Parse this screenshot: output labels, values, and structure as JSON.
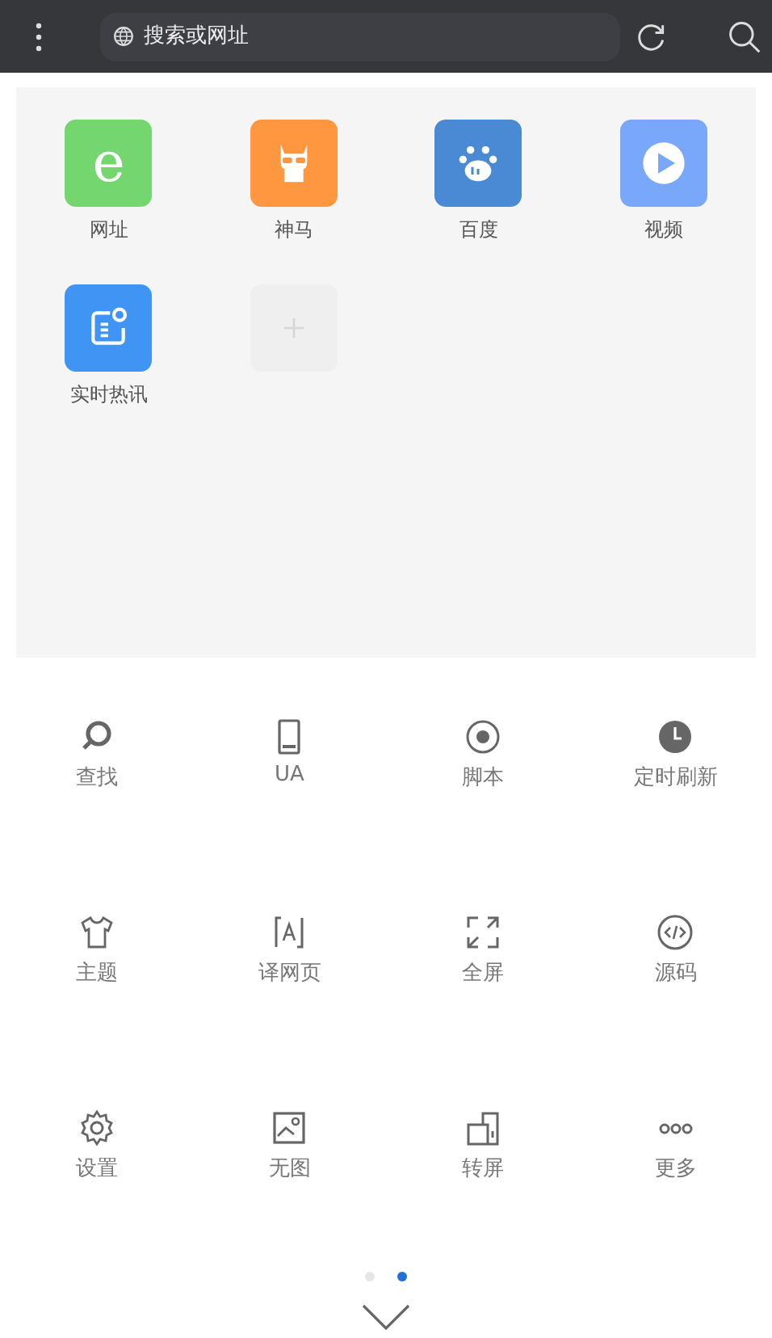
{
  "top_bar": {
    "search_placeholder": "搜索或网址"
  },
  "shortcuts": [
    {
      "kind": "letter",
      "glyph": "e",
      "label": "网址",
      "color": "#74d66f"
    },
    {
      "kind": "llama",
      "label": "神马",
      "color": "#ff9640"
    },
    {
      "kind": "paw",
      "label": "百度",
      "color": "#4a8ad4"
    },
    {
      "kind": "play",
      "label": "视频",
      "color": "#79a8fb"
    },
    {
      "kind": "news",
      "label": "实时热讯",
      "color": "#3f94f4"
    },
    {
      "kind": "add"
    }
  ],
  "menu": [
    {
      "kind": "find",
      "label": "查找"
    },
    {
      "kind": "phone",
      "label": "UA"
    },
    {
      "kind": "script",
      "label": "脚本"
    },
    {
      "kind": "clock",
      "label": "定时刷新"
    },
    {
      "kind": "shirt",
      "label": "主题"
    },
    {
      "kind": "translate",
      "label": "译网页"
    },
    {
      "kind": "fullscreen",
      "label": "全屏"
    },
    {
      "kind": "code",
      "label": "源码"
    },
    {
      "kind": "gear",
      "label": "设置"
    },
    {
      "kind": "image",
      "label": "无图"
    },
    {
      "kind": "rotate",
      "label": "转屏"
    },
    {
      "kind": "more",
      "label": "更多"
    }
  ],
  "pages": [
    {
      "selected": false
    },
    {
      "selected": true
    }
  ]
}
